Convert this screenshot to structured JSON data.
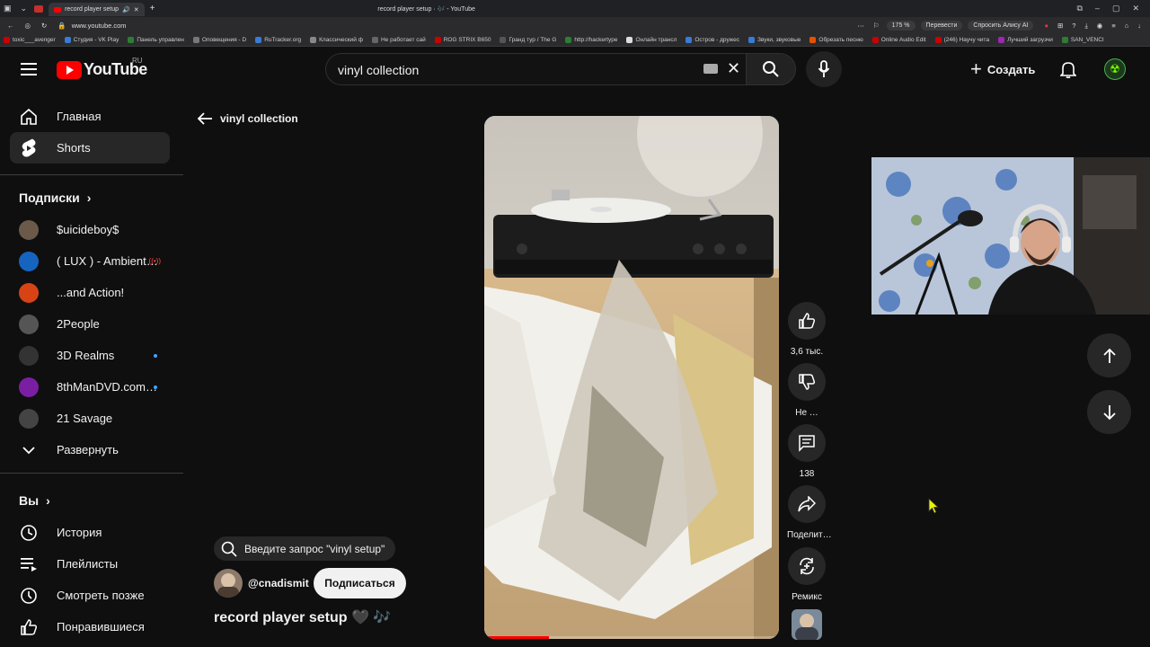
{
  "browser": {
    "tab_title": "record player setup",
    "page_title": "record player setup · 🎶 - YouTube",
    "url": "www.youtube.com",
    "zoom": "175 %",
    "translate": "Перевести",
    "ask_alice": "Спросить Алису AI",
    "bookmarks": [
      {
        "label": "toxic___avenger",
        "color": "#c00"
      },
      {
        "label": "Студия - VK Play",
        "color": "#3a7bd5"
      },
      {
        "label": "Панель управлен",
        "color": "#2e7d32"
      },
      {
        "label": "Оповещения - D",
        "color": "#777"
      },
      {
        "label": "RuTracker.org",
        "color": "#3a7bd5"
      },
      {
        "label": "Классический ф",
        "color": "#888"
      },
      {
        "label": "Не работает сай",
        "color": "#666"
      },
      {
        "label": "ROG STRIX B650",
        "color": "#c00"
      },
      {
        "label": "Гранд тур / The G",
        "color": "#555"
      },
      {
        "label": "http://hackertype",
        "color": "#2e7d32"
      },
      {
        "label": "Онлайн трансл",
        "color": "#ddd"
      },
      {
        "label": "Остров - дружес",
        "color": "#3a7bd5"
      },
      {
        "label": "Звуки, звуковые",
        "color": "#3a7bd5"
      },
      {
        "label": "Обрезать песню",
        "color": "#e65100"
      },
      {
        "label": "Online Audio Edit",
        "color": "#c00"
      },
      {
        "label": "(246) Научу чита",
        "color": "#c00"
      },
      {
        "label": "Лучший загрузчи",
        "color": "#9c27b0"
      },
      {
        "label": "SAN_VENCI",
        "color": "#2e7d32"
      }
    ]
  },
  "header": {
    "logo_text": "YouTube",
    "country": "RU",
    "search_value": "vinyl collection",
    "create_label": "Создать"
  },
  "sidebar": {
    "main": [
      {
        "label": "Главная"
      },
      {
        "label": "Shorts"
      }
    ],
    "subscriptions_title": "Подписки",
    "subscriptions": [
      {
        "label": "$uicideboy$",
        "color": "#6b5a4a",
        "new": false
      },
      {
        "label": "( LUX ) - Ambient…",
        "color": "#1565c0",
        "live": true
      },
      {
        "label": "...and Action!",
        "color": "#d84315",
        "new": false
      },
      {
        "label": "2People",
        "color": "#555",
        "new": false
      },
      {
        "label": "3D Realms",
        "color": "#333",
        "new": true
      },
      {
        "label": "8thManDVD.com…",
        "color": "#7b1fa2",
        "new": true
      },
      {
        "label": "21 Savage",
        "color": "#444",
        "new": false
      }
    ],
    "expand_label": "Развернуть",
    "you_title": "Вы",
    "you_items": [
      {
        "label": "История"
      },
      {
        "label": "Плейлисты"
      },
      {
        "label": "Смотреть позже"
      },
      {
        "label": "Понравившиеся"
      }
    ]
  },
  "shorts": {
    "back_label": "vinyl collection",
    "search_suggestion": "Введите запрос \"vinyl setup\"",
    "channel": "@cnadismit",
    "subscribe_label": "Подписаться",
    "title": "record player setup 🖤 🎶",
    "likes": "3,6 тыс.",
    "dislike_label": "Не …",
    "comments": "138",
    "share_label": "Поделит…",
    "remix_label": "Ремикс",
    "progress": 0.22
  }
}
